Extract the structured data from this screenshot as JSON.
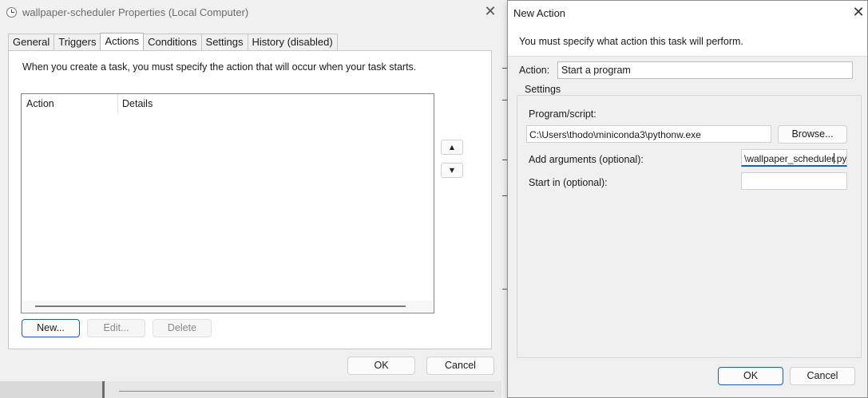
{
  "properties_dialog": {
    "title": "wallpaper-scheduler Properties (Local Computer)",
    "close_glyph": "✕",
    "tabs": [
      {
        "label": "General"
      },
      {
        "label": "Triggers"
      },
      {
        "label": "Actions"
      },
      {
        "label": "Conditions"
      },
      {
        "label": "Settings"
      },
      {
        "label": "History (disabled)"
      }
    ],
    "active_tab": "Actions",
    "description": "When you create a task, you must specify the action that will occur when your task starts.",
    "list": {
      "columns": [
        "Action",
        "Details"
      ],
      "rows": []
    },
    "move_up_glyph": "▲",
    "move_down_glyph": "▼",
    "buttons": {
      "new": "New...",
      "edit": "Edit...",
      "delete": "Delete",
      "ok": "OK",
      "cancel": "Cancel"
    }
  },
  "new_action_dialog": {
    "title": "New Action",
    "close_glyph": "✕",
    "prompt": "You must specify what action this task will perform.",
    "action_label": "Action:",
    "action_value": "Start a program",
    "chevron_glyph": "⌵",
    "settings_caption": "Settings",
    "program_label": "Program/script:",
    "program_value": "C:\\Users\\thodo\\miniconda3\\pythonw.exe",
    "browse_label": "Browse...",
    "arguments_label": "Add arguments (optional):",
    "arguments_value_before_caret": "\\wallpaper_scheduler",
    "arguments_value_after_caret": ".py",
    "start_in_label": "Start in (optional):",
    "start_in_value": "",
    "ok": "OK",
    "cancel": "Cancel"
  },
  "colors": {
    "accent": "#1b5fb5",
    "dialog_bg": "#f0f0f0",
    "panel_bg": "#ffffff"
  }
}
